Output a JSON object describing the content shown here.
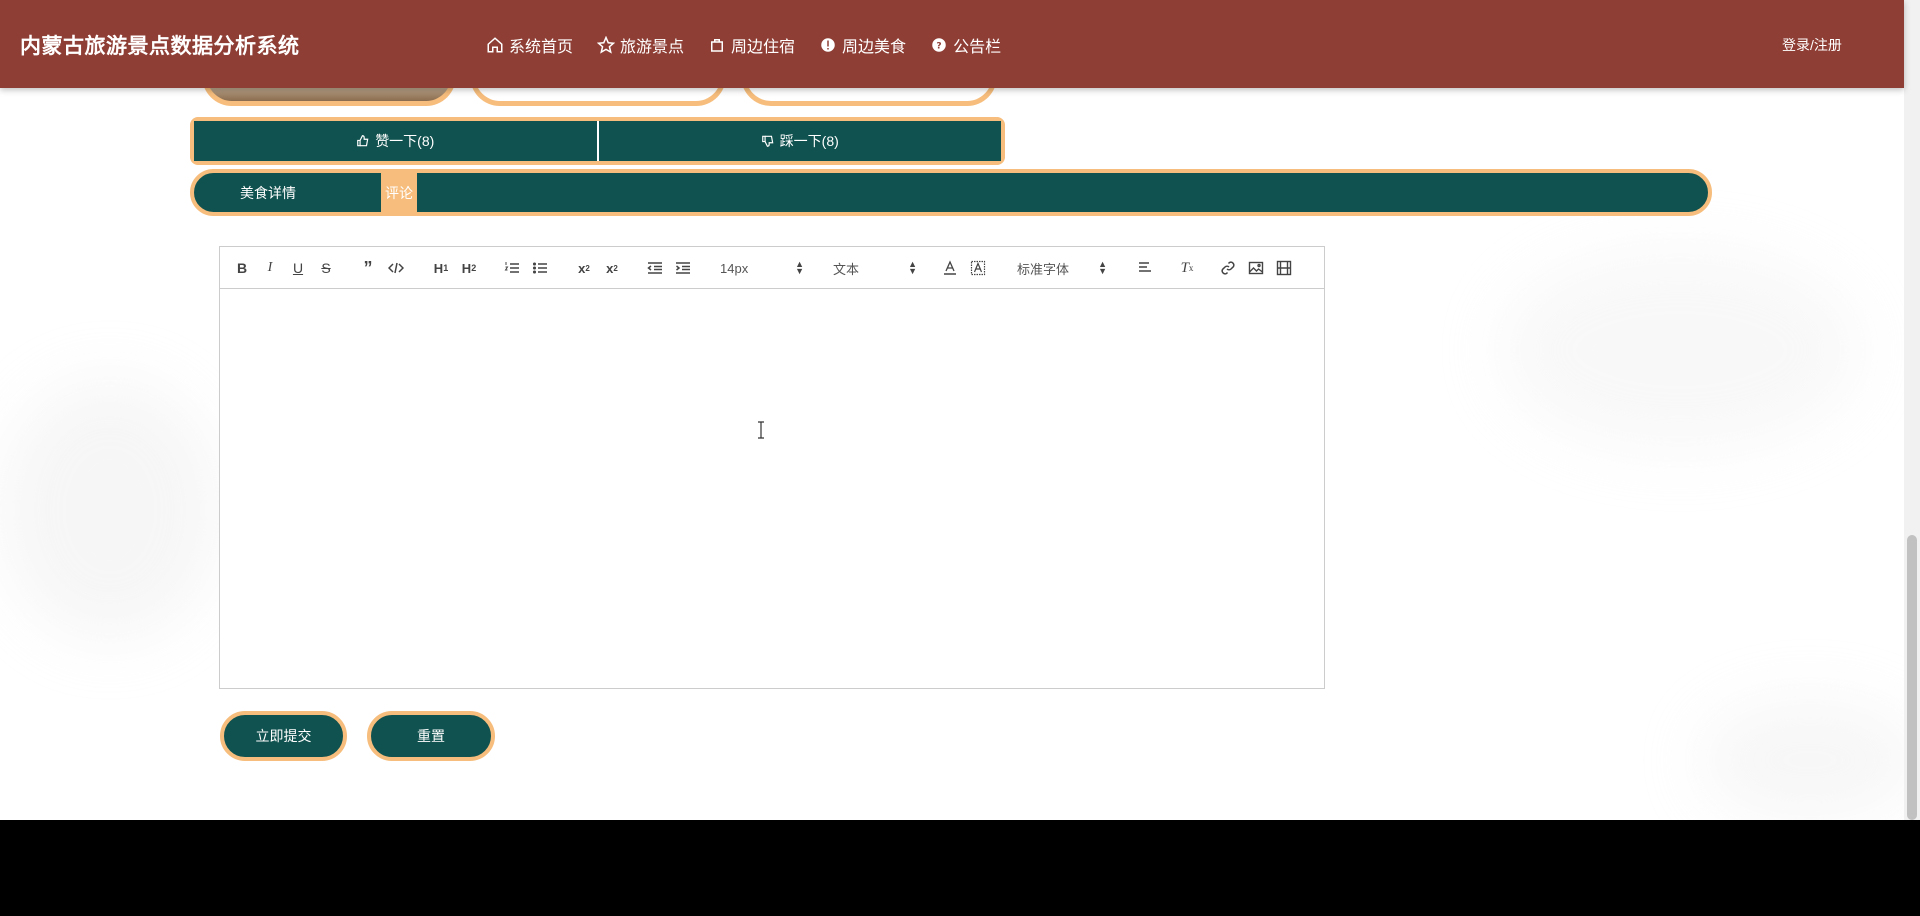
{
  "header": {
    "site_title": "内蒙古旅游景点数据分析系统",
    "nav": [
      {
        "label": "系统首页",
        "icon": "home-icon"
      },
      {
        "label": "旅游景点",
        "icon": "star-icon"
      },
      {
        "label": "周边住宿",
        "icon": "bag-icon"
      },
      {
        "label": "周边美食",
        "icon": "info-circle-icon"
      },
      {
        "label": "公告栏",
        "icon": "question-circle-icon"
      }
    ],
    "login_label": "登录/注册"
  },
  "vote": {
    "like_label": "赞一下(8)",
    "dislike_label": "踩一下(8)"
  },
  "tabs": [
    {
      "label": "美食详情",
      "active": false
    },
    {
      "label": "评论",
      "active": true
    }
  ],
  "editor": {
    "font_size": "14px",
    "text_type": "文本",
    "font_family": "标准字体",
    "tools": [
      "bold",
      "italic",
      "underline",
      "strike",
      "blockquote",
      "code-block",
      "header-1",
      "header-2",
      "ordered-list",
      "bullet-list",
      "subscript",
      "superscript",
      "outdent",
      "indent",
      "font-color",
      "background-color",
      "align",
      "clean",
      "link",
      "image",
      "video"
    ]
  },
  "actions": {
    "submit_label": "立即提交",
    "reset_label": "重置"
  },
  "colors": {
    "header_bg": "#8f3e35",
    "primary_green": "#10524f",
    "accent_orange": "#f6bd7c",
    "footer_bg": "#000000"
  }
}
